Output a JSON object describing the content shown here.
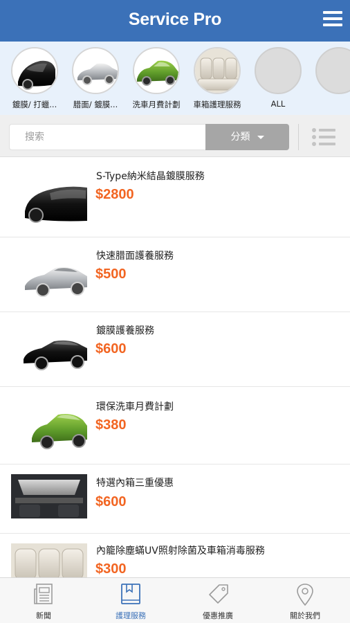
{
  "header": {
    "title": "Service Pro",
    "menu_icon": "hamburger-menu-icon"
  },
  "categories": [
    {
      "label": "鍍膜/ 打蠟...",
      "image": "black-car-front-photo"
    },
    {
      "label": "腊面/ 鍍膜...",
      "image": "silver-car-photo"
    },
    {
      "label": "洗車月費計劃",
      "image": "green-car-photo"
    },
    {
      "label": "車箱護理服務",
      "image": "car-interior-seats-photo"
    },
    {
      "label": "ALL",
      "image": ""
    },
    {
      "label": "",
      "image": ""
    }
  ],
  "search": {
    "placeholder": "搜索",
    "category_button": "分類",
    "view_toggle_icon": "list-view-icon"
  },
  "products": [
    {
      "name": "S-Type納米結晶鍍膜服務",
      "price": "$2800",
      "image": "black-car-side-photo"
    },
    {
      "name": "快速腊面護養服務",
      "price": "$500",
      "image": "silver-car-photo"
    },
    {
      "name": "鍍膜護養服務",
      "price": "$600",
      "image": "black-sedan-photo"
    },
    {
      "name": "環保洗車月費計劃",
      "price": "$380",
      "image": "green-car-photo"
    },
    {
      "name": "特選內箱三重優惠",
      "price": "$600",
      "image": "car-interior-dashboard-photo"
    },
    {
      "name": "內籠除塵蟎UV照射除菌及車箱消毒服務",
      "price": "$300",
      "image": "car-interior-seats-photo"
    }
  ],
  "tabs": [
    {
      "label": "新聞",
      "icon": "newspaper-icon"
    },
    {
      "label": "護理服務",
      "icon": "book-icon",
      "active": true
    },
    {
      "label": "優惠推廣",
      "icon": "tag-icon"
    },
    {
      "label": "關於我們",
      "icon": "location-pin-icon"
    }
  ],
  "colors": {
    "header": "#3b71b8",
    "price": "#f26522",
    "active_tab": "#3b71b8",
    "category_strip": "#e8f1fb"
  }
}
